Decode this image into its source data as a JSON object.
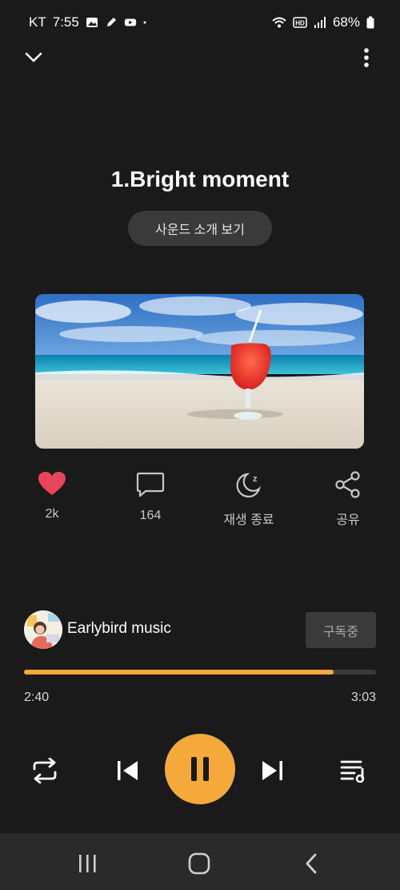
{
  "status_bar": {
    "carrier": "KT",
    "time": "7:55",
    "battery": "68%",
    "icons": [
      "image-icon",
      "edit-icon",
      "youtube-icon",
      "dot-icon",
      "wifi-icon",
      "hd-icon",
      "signal-icon",
      "battery-icon"
    ]
  },
  "header": {
    "collapse_icon": "chevron-down-icon",
    "menu_icon": "more-vertical-icon"
  },
  "track": {
    "title": "1.Bright moment",
    "sound_intro_label": "사운드 소개 보기",
    "cover_alt": "beach-drink-artwork"
  },
  "actions": [
    {
      "name": "like",
      "icon": "heart-icon",
      "label": "2k",
      "color": "#e8445a"
    },
    {
      "name": "comments",
      "icon": "comment-icon",
      "label": "164"
    },
    {
      "name": "sleep-timer",
      "icon": "moon-icon",
      "label": "재생 종료"
    },
    {
      "name": "share",
      "icon": "share-icon",
      "label": "공유"
    }
  ],
  "artist": {
    "name": "Earlybird music",
    "subscribe_label": "구독중"
  },
  "playback": {
    "elapsed": "2:40",
    "duration": "3:03",
    "progress": 0.88,
    "accent": "#f6a93b"
  },
  "controls": {
    "repeat_icon": "repeat-icon",
    "prev_icon": "skip-previous-icon",
    "play_state_icon": "pause-icon",
    "next_icon": "skip-next-icon",
    "queue_icon": "playlist-icon"
  },
  "nav": {
    "recents_icon": "recents-icon",
    "home_icon": "home-icon",
    "back_icon": "back-icon"
  }
}
